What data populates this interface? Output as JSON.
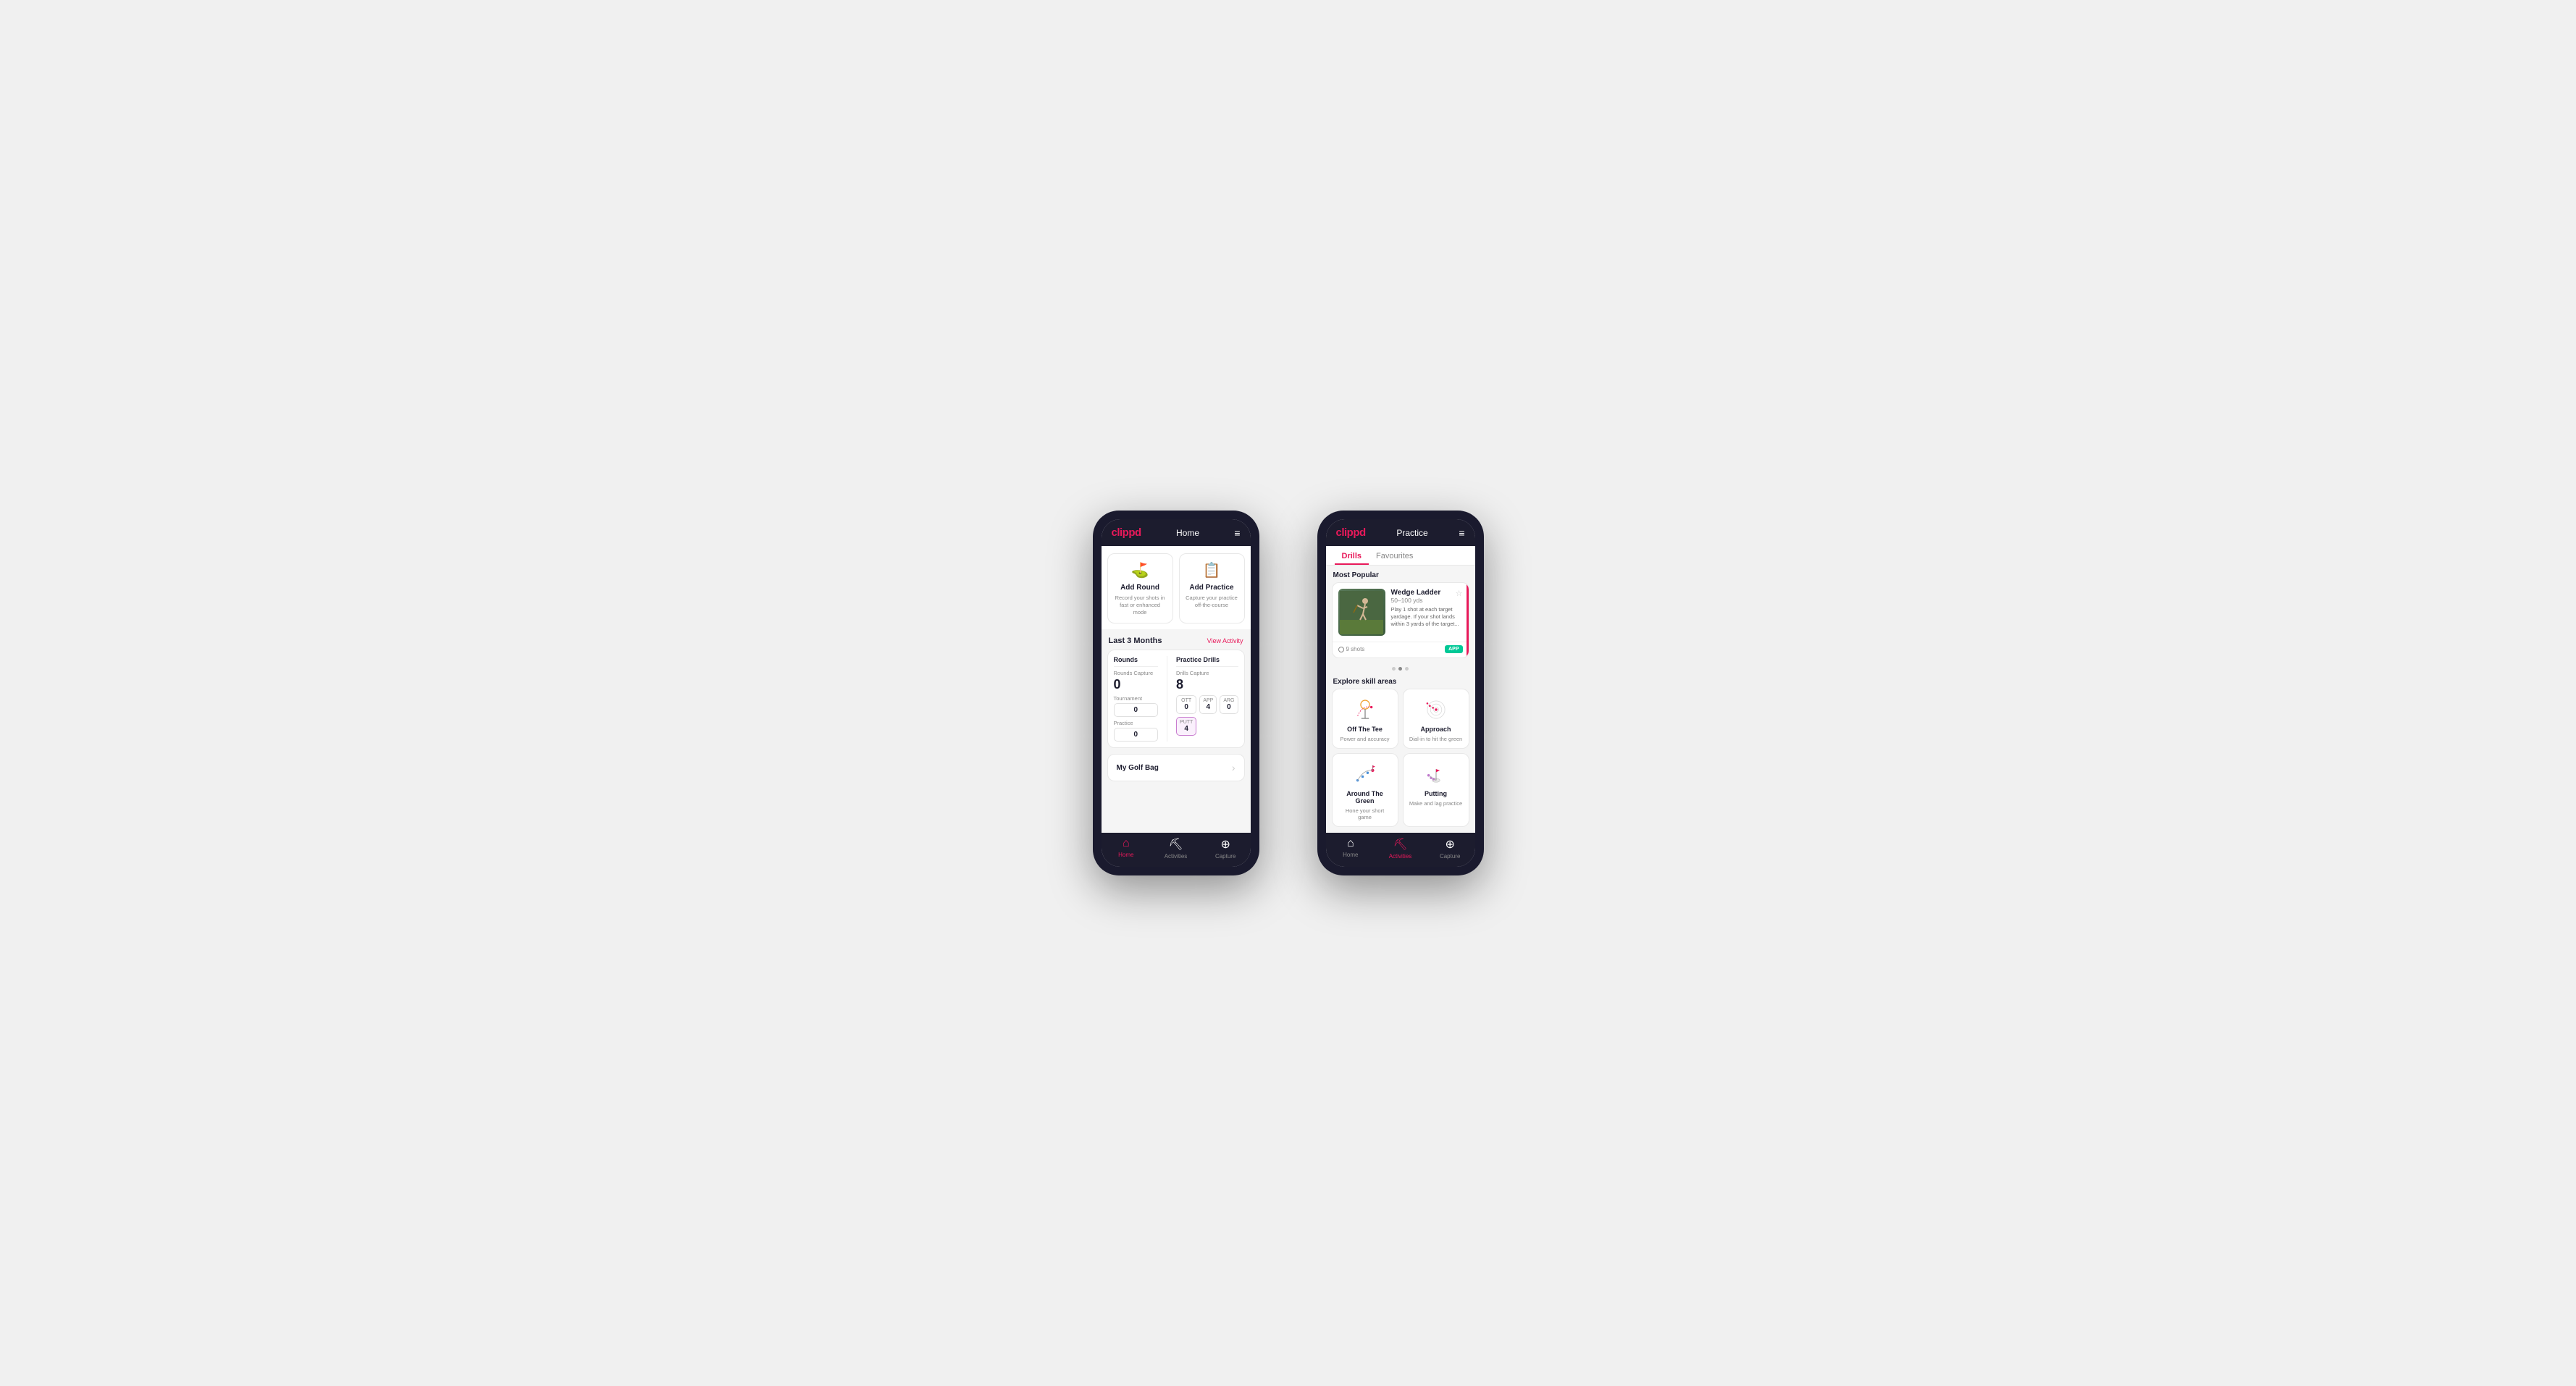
{
  "phone1": {
    "header": {
      "logo": "clippd",
      "title": "Home",
      "menu_icon": "≡"
    },
    "actions": [
      {
        "id": "add-round",
        "icon": "⛳",
        "title": "Add Round",
        "subtitle": "Record your shots in fast or enhanced mode"
      },
      {
        "id": "add-practice",
        "icon": "📋",
        "title": "Add Practice",
        "subtitle": "Capture your practice off-the-course"
      }
    ],
    "activity_section": {
      "title": "Last 3 Months",
      "link": "View Activity"
    },
    "rounds": {
      "col_title": "Rounds",
      "capture_label": "Rounds Capture",
      "big_value": "0",
      "tournament_label": "Tournament",
      "tournament_value": "0",
      "practice_label": "Practice",
      "practice_value": "0"
    },
    "drills": {
      "col_title": "Practice Drills",
      "capture_label": "Drills Capture",
      "big_value": "8",
      "stats": [
        {
          "label": "OTT",
          "value": "0"
        },
        {
          "label": "APP",
          "value": "4",
          "highlight": true
        },
        {
          "label": "ARG",
          "value": "0"
        },
        {
          "label": "PUTT",
          "value": "4",
          "highlight": true
        }
      ]
    },
    "golf_bag": {
      "label": "My Golf Bag",
      "arrow": "›"
    },
    "nav": [
      {
        "icon": "⌂",
        "label": "Home",
        "active": true
      },
      {
        "icon": "♟",
        "label": "Activities",
        "active": false
      },
      {
        "icon": "⊕",
        "label": "Capture",
        "active": false
      }
    ]
  },
  "phone2": {
    "header": {
      "logo": "clippd",
      "title": "Practice",
      "menu_icon": "≡"
    },
    "tabs": [
      {
        "label": "Drills",
        "active": true
      },
      {
        "label": "Favourites",
        "active": false
      }
    ],
    "most_popular_label": "Most Popular",
    "drill_card": {
      "title": "Wedge Ladder",
      "yardage": "50–100 yds",
      "description": "Play 1 shot at each target yardage. If your shot lands within 3 yards of the target...",
      "shots": "9 shots",
      "badge": "APP",
      "star": "☆"
    },
    "dots": [
      false,
      true,
      false
    ],
    "explore_label": "Explore skill areas",
    "skills": [
      {
        "id": "off-the-tee",
        "name": "Off The Tee",
        "desc": "Power and accuracy",
        "icon": "tee"
      },
      {
        "id": "approach",
        "name": "Approach",
        "desc": "Dial-in to hit the green",
        "icon": "approach"
      },
      {
        "id": "around-the-green",
        "name": "Around The Green",
        "desc": "Hone your short game",
        "icon": "around"
      },
      {
        "id": "putting",
        "name": "Putting",
        "desc": "Make and lag practice",
        "icon": "putting"
      }
    ],
    "nav": [
      {
        "icon": "⌂",
        "label": "Home",
        "active": false
      },
      {
        "icon": "♟",
        "label": "Activities",
        "active": true
      },
      {
        "icon": "⊕",
        "label": "Capture",
        "active": false
      }
    ]
  }
}
